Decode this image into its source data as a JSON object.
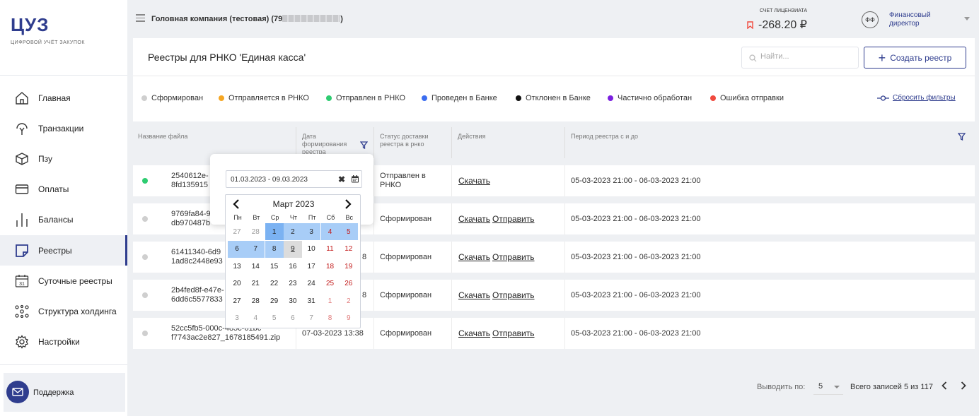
{
  "sidebar": {
    "logo": "ЦУЗ",
    "logo_subtitle": "цифровой учёт закупок",
    "items": [
      {
        "label": "Главная",
        "icon": "home-icon"
      },
      {
        "label": "Транзакции",
        "icon": "transactions-icon"
      },
      {
        "label": "Пзу",
        "icon": "box-icon"
      },
      {
        "label": "Оплаты",
        "icon": "card-icon"
      },
      {
        "label": "Балансы",
        "icon": "balance-bars-icon"
      },
      {
        "label": "Реестры",
        "icon": "registry-icon"
      },
      {
        "label": "Суточные реестры",
        "icon": "calendar-31-icon"
      },
      {
        "label": "Структура холдинга",
        "icon": "holding-structure-icon"
      },
      {
        "label": "Настройки",
        "icon": "gear-icon"
      }
    ],
    "active_item": "Реестры",
    "support_label": "Поддержка"
  },
  "topbar": {
    "company": "Головная компания (тестовая) (79",
    "account_caption": "СЧЕТ ЛИЦЕНЗИАТА",
    "account_balance": "-268.20 ₽",
    "avatar_initials": "ФФ",
    "role": "Финансовый директор"
  },
  "header": {
    "title": "Реестры для РНКО 'Единая касса'",
    "search_placeholder": "Найти...",
    "create_button": "Создать реестр"
  },
  "filters": {
    "statuses": [
      {
        "label": "Сформирован",
        "color": "#cfcfcf"
      },
      {
        "label": "Отправляется в РНКО",
        "color": "#f5a623"
      },
      {
        "label": "Отправлен в РНКО",
        "color": "#2ecc71"
      },
      {
        "label": "Проведен в Банке",
        "color": "#3b6df0"
      },
      {
        "label": "Отклонен в Банке",
        "color": "#111111"
      },
      {
        "label": "Частично обработан",
        "color": "#7b1fe0"
      },
      {
        "label": "Ошибка отправки",
        "color": "#f04a3e"
      }
    ],
    "reset_label": "Сбросить фильтры"
  },
  "table": {
    "headers": {
      "file": "Название файла",
      "date_line1": "Дата",
      "date_line2": "формирования",
      "date_line3": "реестра",
      "status_line1": "Статус доставки",
      "status_line2": "реестра в рнко",
      "actions": "Действия",
      "period": "Период реестра с и до"
    },
    "download_label": "Скачать",
    "send_label": "Отправить",
    "rows": [
      {
        "file1": "2540612e-",
        "file2": "8fd135915",
        "date": "",
        "status1": "Отправлен в",
        "status2": "РНКО",
        "period": "05-03-2023 21:00 - 06-03-2023 21:00",
        "dot": "#2ecc71",
        "send": false
      },
      {
        "file1": "9769fa84-9",
        "file2": "db970487b",
        "date": "",
        "status1": "Сформирован",
        "status2": "",
        "period": "05-03-2023 21:00 - 06-03-2023 21:00",
        "dot": "#cfcfcf",
        "send": true
      },
      {
        "file1": "61411340-6d9",
        "file2": "1ad8c2448e93",
        "date": "8",
        "status1": "Сформирован",
        "status2": "",
        "period": "05-03-2023 21:00 - 06-03-2023 21:00",
        "dot": "#cfcfcf",
        "send": true
      },
      {
        "file1": "2b4fed8f-e47e-",
        "file2": "6dd6c5577833",
        "date": "8",
        "status1": "Сформирован",
        "status2": "",
        "period": "05-03-2023 21:00 - 06-03-2023 21:00",
        "dot": "#cfcfcf",
        "send": true
      },
      {
        "file1": "52cc5fb5-000c-485c-61bc",
        "file2": "f7743ac2e827_1678185491.zip",
        "date": "07-03-2023 13:38",
        "status1": "Сформирован",
        "status2": "",
        "period": "05-03-2023 21:00 - 06-03-2023 21:00",
        "dot": "#cfcfcf",
        "send": true
      }
    ]
  },
  "date_filter": {
    "value": "01.03.2023 - 09.03.2023",
    "clear_symbol": "✖",
    "month_label": "Март 2023",
    "weekdays": [
      "Пн",
      "Вт",
      "Ср",
      "Чт",
      "Пт",
      "Сб",
      "Вс"
    ],
    "weeks": [
      [
        "27",
        "28",
        "1",
        "2",
        "3",
        "4",
        "5"
      ],
      [
        "6",
        "7",
        "8",
        "9",
        "10",
        "11",
        "12"
      ],
      [
        "13",
        "14",
        "15",
        "16",
        "17",
        "18",
        "19"
      ],
      [
        "20",
        "21",
        "22",
        "23",
        "24",
        "25",
        "26"
      ],
      [
        "27",
        "28",
        "29",
        "30",
        "31",
        "1",
        "2"
      ],
      [
        "3",
        "4",
        "5",
        "6",
        "7",
        "8",
        "9"
      ]
    ],
    "range_start": "1",
    "range_end": "9",
    "today": "9"
  },
  "pagination": {
    "per_page_label": "Выводить по:",
    "per_page": "5",
    "total": "Всего записей 5 из 117"
  },
  "colors": {
    "brand": "#2f3d8e",
    "range": "#a8cdf7",
    "range_start": "#7bb2f2"
  }
}
